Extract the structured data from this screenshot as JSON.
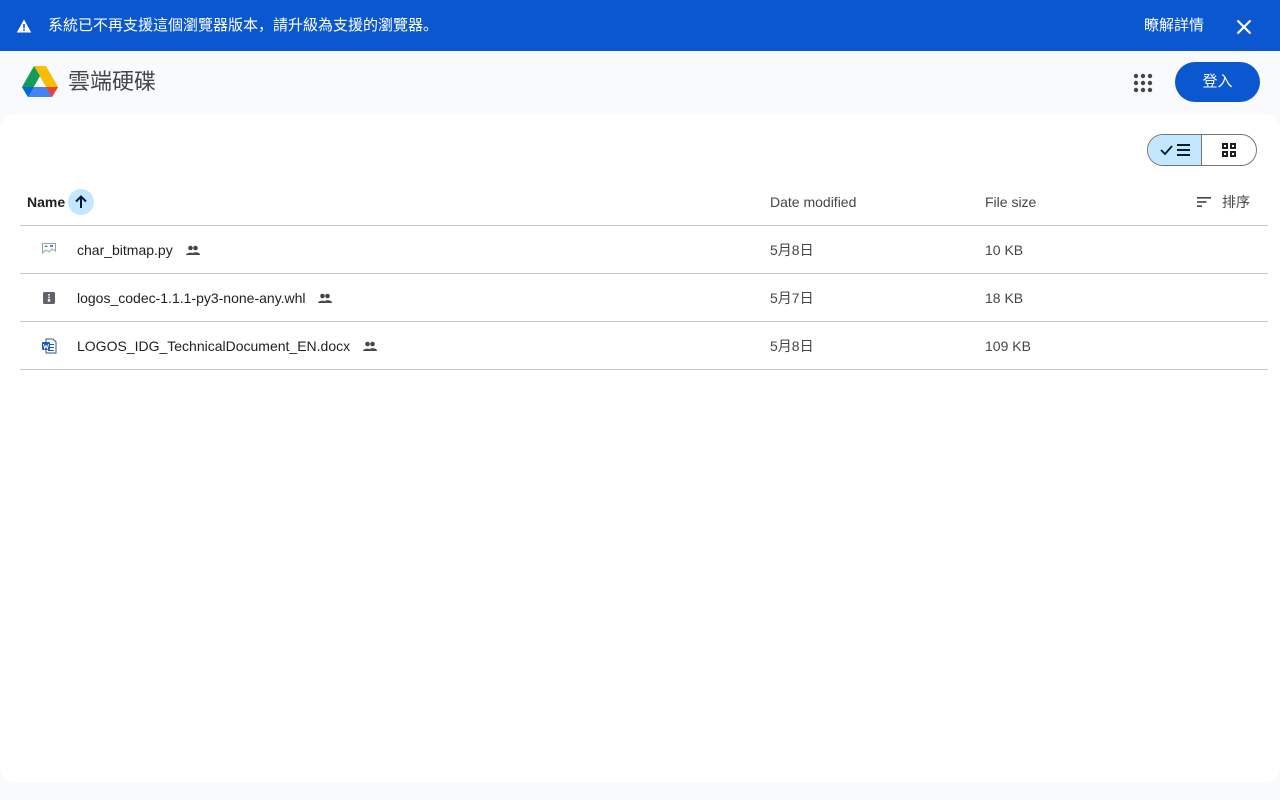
{
  "banner": {
    "message": "系統已不再支援這個瀏覽器版本，請升級為支援的瀏覽器。",
    "learn_more": "瞭解詳情",
    "bg_color": "#0b57d0",
    "icons": [
      "warning-icon",
      "close-icon"
    ]
  },
  "header": {
    "product_name": "雲端硬碟",
    "signin_label": "登入",
    "icons": [
      "google-drive-logo",
      "apps-grid-icon"
    ]
  },
  "toolbar": {
    "view_modes": [
      "list",
      "grid"
    ],
    "active_view": "list"
  },
  "table": {
    "columns": {
      "name": "Name",
      "date": "Date modified",
      "size": "File size",
      "sort_label": "排序"
    },
    "sort": "name-ascending",
    "rows": [
      {
        "name": "char_bitmap.py",
        "date": "5月8日",
        "size": "10 KB",
        "icon": "broken-image-icon",
        "shared": true
      },
      {
        "name": "logos_codec-1.1.1-py3-none-any.whl",
        "date": "5月7日",
        "size": "18 KB",
        "icon": "archive-file-icon",
        "shared": true
      },
      {
        "name": "LOGOS_IDG_TechnicalDocument_EN.docx",
        "date": "5月8日",
        "size": "109 KB",
        "icon": "word-doc-icon",
        "shared": true
      }
    ]
  },
  "colors": {
    "accent": "#0b57d0",
    "selected": "#c2e7ff",
    "page_bg": "#f8fafd",
    "divider": "#c7c7c7"
  }
}
